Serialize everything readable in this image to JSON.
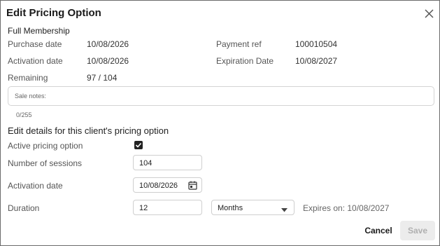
{
  "dialog": {
    "title": "Edit Pricing Option"
  },
  "summary": {
    "name": "Full Membership",
    "purchase_date_label": "Purchase date",
    "purchase_date": "10/08/2026",
    "payment_ref_label": "Payment ref",
    "payment_ref": "100010504",
    "activation_date_label": "Activation date",
    "activation_date": "10/08/2026",
    "expiration_date_label": "Expiration Date",
    "expiration_date": "10/08/2027",
    "remaining_label": "Remaining",
    "remaining": "97 / 104"
  },
  "notes": {
    "placeholder": "Sale notes:",
    "counter": "0/255"
  },
  "edit": {
    "section_title": "Edit details for this client's pricing option",
    "active_label": "Active pricing option",
    "active_checked": true,
    "sessions_label": "Number of sessions",
    "sessions_value": "104",
    "activation_label": "Activation date",
    "activation_value": "10/08/2026",
    "duration_label": "Duration",
    "duration_value": "12",
    "duration_unit": "Months",
    "expires_text": "Expires on: 10/08/2027"
  },
  "footer": {
    "cancel_label": "Cancel",
    "save_label": "Save"
  },
  "icons": {
    "close": "close-icon",
    "calendar": "calendar-icon",
    "dropdown": "chevron-down-icon",
    "check": "checkmark-icon"
  },
  "colors": {
    "border": "#6b6b6b",
    "save_disabled_bg": "#ececec",
    "save_disabled_text": "#b0b0b0"
  }
}
